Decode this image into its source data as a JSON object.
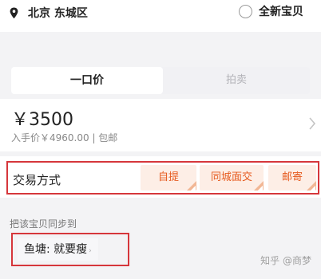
{
  "location": {
    "icon": "map-pin-icon",
    "text": "北京 东城区"
  },
  "condition": {
    "icon": "radio-unchecked-icon",
    "label": "全新宝贝"
  },
  "tabs": {
    "fixed_price": "一口价",
    "auction": "拍卖",
    "active": "fixed_price"
  },
  "price": {
    "amount": "￥3500",
    "bought_price": "入手价￥4960.00 | 包邮",
    "chevron_icon": "chevron-right-icon"
  },
  "trade": {
    "label": "交易方式",
    "options": [
      {
        "label": "自提"
      },
      {
        "label": "同城面交"
      },
      {
        "label": "邮寄"
      }
    ]
  },
  "sync": {
    "label": "把该宝贝同步到",
    "chip": "鱼塘: 就要瘦",
    "chip_arrow": "›"
  },
  "watermark": "知乎 @商梦",
  "colors": {
    "accent": "#e65a1e",
    "option_bg": "#fdeee6",
    "highlight_border": "#d6363b"
  }
}
